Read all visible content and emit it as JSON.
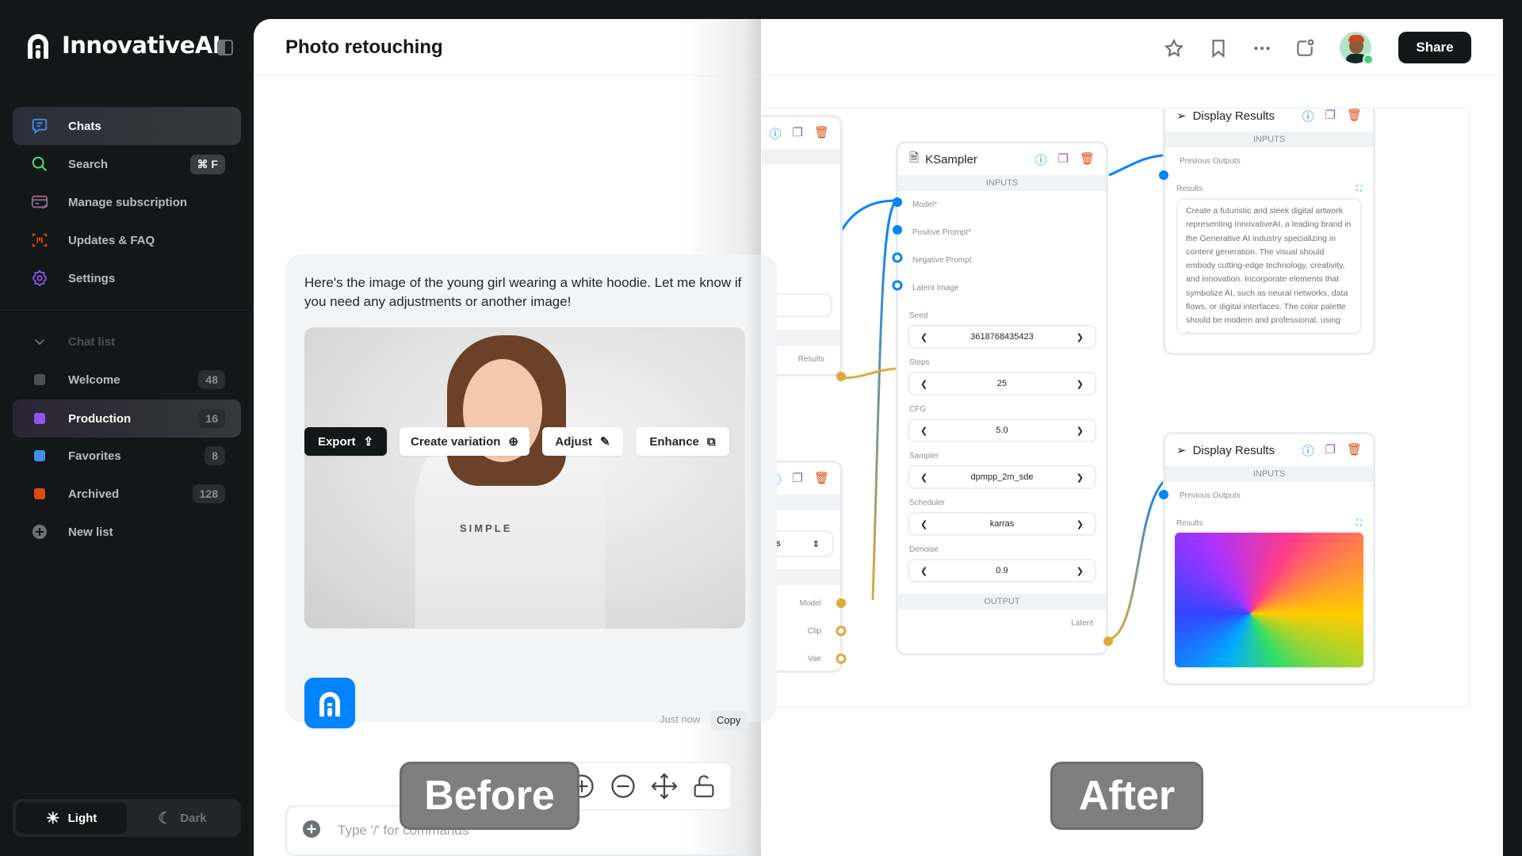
{
  "app": {
    "name": "InnovativeAI"
  },
  "sidebar": {
    "nav": [
      {
        "label": "Chats",
        "icon": "chat-icon",
        "color": "#3e90f0",
        "active": true
      },
      {
        "label": "Search",
        "icon": "search-icon",
        "color": "#4ade80",
        "shortcut": "⌘ F"
      },
      {
        "label": "Manage subscription",
        "icon": "card-icon",
        "color": "#8e55ea"
      },
      {
        "label": "Updates & FAQ",
        "icon": "updates-icon",
        "color": "#d84c10"
      },
      {
        "label": "Settings",
        "icon": "gear-icon",
        "color": "#8e55ea"
      }
    ],
    "chat_list_label": "Chat list",
    "lists": [
      {
        "label": "Welcome",
        "count": "48",
        "color": "#4b5052"
      },
      {
        "label": "Production",
        "count": "16",
        "color": "#8e55ea",
        "active": true
      },
      {
        "label": "Favorites",
        "count": "8",
        "color": "#3e90f0"
      },
      {
        "label": "Archived",
        "count": "128",
        "color": "#d84c10"
      }
    ],
    "new_list": "New list",
    "theme": {
      "light": "Light",
      "dark": "Dark",
      "selected": "Light"
    }
  },
  "header": {
    "title": "Photo retouching",
    "share": "Share"
  },
  "chat": {
    "message": "Here's the image of the young girl wearing a white hoodie. Let me know if you need any adjustments or another image!",
    "hoodie_text": "SIMPLE",
    "actions": [
      "Export",
      "Create variation",
      "Adjust",
      "Enhance"
    ],
    "time": "Just now",
    "copy": "Copy",
    "input_placeholder": "Type '/' for commands"
  },
  "labels": {
    "before": "Before",
    "after": "After"
  },
  "workflow": {
    "left_nodes": {
      "results": "Results",
      "select_value": "nsors",
      "outputs": [
        "Model",
        "Clip",
        "Vae"
      ]
    },
    "ksampler": {
      "title": "KSampler",
      "inputs_label": "INPUTS",
      "inputs": [
        "Model*",
        "Positive Prompt*",
        "Negative Prompt",
        "Latent Image"
      ],
      "fields": [
        {
          "label": "Seed",
          "value": "3618768435423"
        },
        {
          "label": "Steps",
          "value": "25"
        },
        {
          "label": "CFG",
          "value": "5.0"
        },
        {
          "label": "Sampler",
          "value": "dpmpp_2m_sde"
        },
        {
          "label": "Scheduler",
          "value": "karras"
        },
        {
          "label": "Denoise",
          "value": "0.9"
        }
      ],
      "output_label": "OUTPUT",
      "output": "Latent"
    },
    "display1": {
      "title": "Display Results",
      "inputs_label": "INPUTS",
      "input": "Previous Outputs",
      "results_label": "Results",
      "text": "Create a futuristic and sleek digital artwork representing InnovativeAI, a leading brand in the Generative AI industry specializing in content generation. The visual should embody cutting-edge technology, creativity, and innovation. Incorporate elements that symbolize AI, such as neural networks, data flows, or digital interfaces. The color palette should be modern and professional, using s..."
    },
    "display2": {
      "title": "Display Results",
      "inputs_label": "INPUTS",
      "input": "Previous Outputs",
      "results_label": "Results"
    }
  },
  "colors": {
    "accent": "#0084ff",
    "wire_blue": "#0084ff",
    "wire_gold": "#e0a83a",
    "info": "#0084ff",
    "duplicate": "#8e55ea",
    "delete": "#d84c10"
  }
}
